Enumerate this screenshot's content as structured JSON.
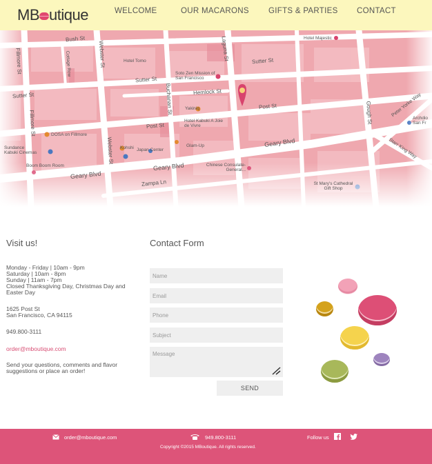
{
  "brand": {
    "logo_text_pre": "MB",
    "logo_text_post": "utique",
    "logo_icon": "macaron-logo-icon"
  },
  "nav": [
    {
      "label": "WELCOME"
    },
    {
      "label": "OUR MACARONS"
    },
    {
      "label": "GIFTS & PARTIES"
    },
    {
      "label": "CONTACT"
    }
  ],
  "map": {
    "streets": [
      "Bush St",
      "Laguna St",
      "Fillmore St",
      "Cottage Row",
      "Webster St",
      "Sutter St",
      "Sutter St",
      "Sutter St",
      "Hemlock St",
      "Post St",
      "Post St",
      "Buchanan St",
      "Geary Blvd",
      "Geary Blvd",
      "Geary Blvd",
      "Zampa Ln",
      "Gough St",
      "Peter Yorke Way",
      "Starr King Way",
      "Fillmore St",
      "Webster St"
    ],
    "places": [
      "Hotel Majestic",
      "Hotel Tomo",
      "Soto Zen Mission of San Francisco",
      "Yakiniq",
      "Hotel Kabuki A Joie de Vivre",
      "DOSA on Fillmore",
      "Sundance Kabuki Cinemas",
      "Boom Boom Room",
      "Kohshi",
      "Japan Center",
      "Glam-Up",
      "Chinese Consulate-General...",
      "St Mary's Cathedral Gift Shop",
      "Archdio San Fr"
    ]
  },
  "visit": {
    "title": "Visit us!",
    "hours": [
      "Monday - Friday | 10am - 9pm",
      "Saturday | 10am - 8pm",
      "Sunday | 11am - 7pm",
      "Closed Thanksgiving Day, Christmas Day and",
      "Easter Day"
    ],
    "address": [
      "1625 Post St",
      "San Francisco, CA 94115"
    ],
    "phone": "949.800-3111",
    "email": "order@mboutique.com",
    "note": [
      "Send your questions, comments and flavor",
      "suggestions or place an order!"
    ]
  },
  "form": {
    "title": "Contact Form",
    "name_placeholder": "Name",
    "email_placeholder": "Email",
    "phone_placeholder": "Phone",
    "subject_placeholder": "Subject",
    "message_placeholder": "Message",
    "send_label": "SEND"
  },
  "footer": {
    "email": "order@mboutique.com",
    "phone": "949.800-3111",
    "follow": "Follow us",
    "copyright": "Copyright ©2015 MBoutique. All rights reserved."
  },
  "colors": {
    "header_bg": "#fcf7bd",
    "accent": "#dd5479",
    "link": "#d84e74"
  }
}
